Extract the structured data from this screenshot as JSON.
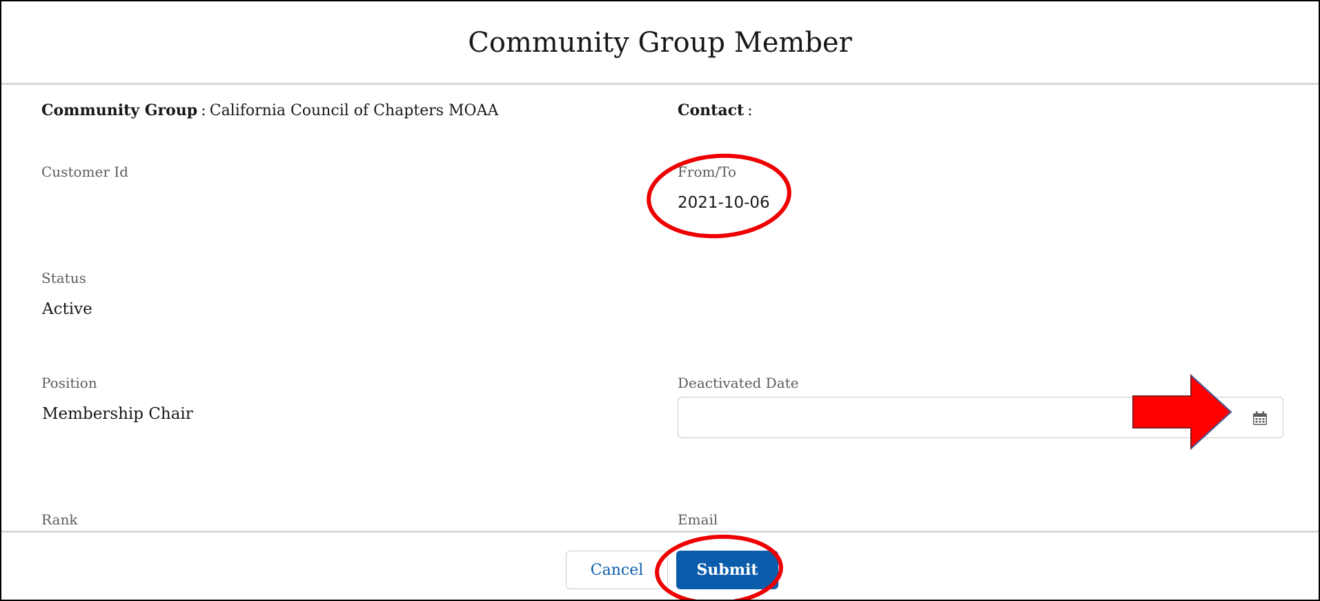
{
  "modal": {
    "title": "Community Group Member"
  },
  "fields": {
    "community_group": {
      "label": "Community Group",
      "separator": ":",
      "value": "California Council of Chapters MOAA"
    },
    "contact": {
      "label": "Contact",
      "separator": ":",
      "value": ""
    },
    "customer_id": {
      "label": "Customer Id",
      "value": ""
    },
    "from_to": {
      "label": "From/To",
      "value": "2021-10-06"
    },
    "status": {
      "label": "Status",
      "value": "Active"
    },
    "position": {
      "label": "Position",
      "value": "Membership Chair"
    },
    "deactivated_date": {
      "label": "Deactivated Date",
      "value": "",
      "placeholder": "",
      "icon": "calendar-icon"
    },
    "rank": {
      "label": "Rank"
    },
    "email": {
      "label": "Email"
    }
  },
  "footer": {
    "cancel_label": "Cancel",
    "submit_label": "Submit"
  },
  "colors": {
    "brand_blue": "#0b5cab",
    "annotation_red": "#ee0000",
    "label_gray": "#5c5c5c",
    "text": "#181818",
    "divider": "#d8d8d8"
  },
  "annotations": {
    "from_to_highlight": "red-ellipse",
    "submit_highlight": "red-ellipse",
    "calendar_pointer": "red-arrow"
  }
}
